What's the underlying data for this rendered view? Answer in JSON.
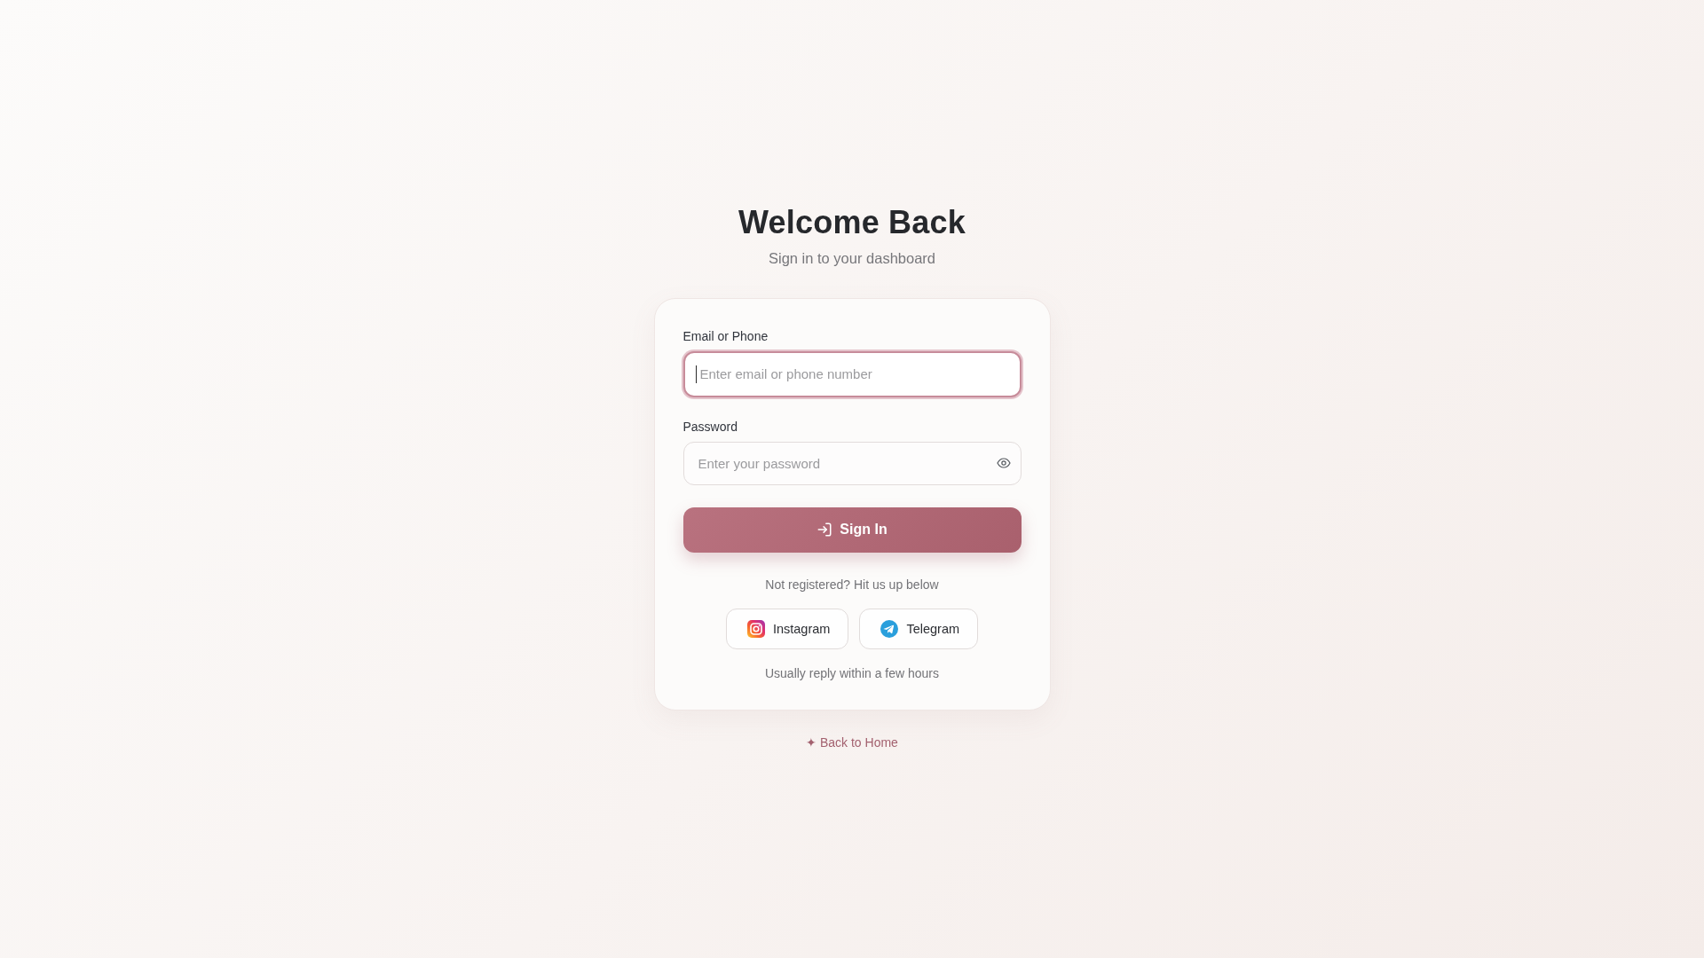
{
  "header": {
    "title": "Welcome Back",
    "subtitle": "Sign in to your dashboard"
  },
  "form": {
    "fields": [
      {
        "kind": "text",
        "label": "Email or Phone",
        "placeholder": "Enter email or phone number",
        "focused": true
      },
      {
        "kind": "password",
        "label": "Password",
        "placeholder": "Enter your password",
        "focused": false
      }
    ],
    "submit_button": "Sign In",
    "register_prompt": "Not registered? Hit us up below",
    "contacts": [
      {
        "kind": "instagram",
        "label": "Instagram"
      },
      {
        "kind": "telegram",
        "label": "Telegram"
      }
    ],
    "reply_note": "Usually reply within a few hours"
  },
  "back_link": "✦ Back to Home"
}
